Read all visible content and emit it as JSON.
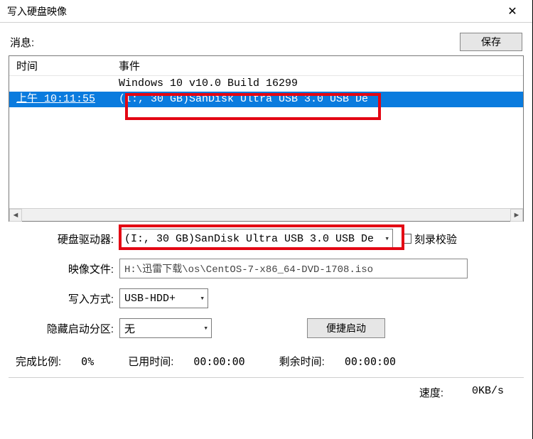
{
  "titlebar": {
    "title": "写入硬盘映像"
  },
  "messages": {
    "label": "消息:",
    "save_button": "保存"
  },
  "log": {
    "col_time": "时间",
    "col_event": "事件",
    "rows": [
      {
        "time": "",
        "event": "Windows 10 v10.0 Build 16299"
      },
      {
        "time": "上午 10:11:55",
        "event": "(I:, 30 GB)SanDisk Ultra USB 3.0 USB De"
      }
    ]
  },
  "form": {
    "drive_label": "硬盘驱动器:",
    "drive_value": "(I:, 30 GB)SanDisk Ultra USB 3.0 USB De",
    "verify_label": "刻录校验",
    "image_label": "映像文件:",
    "image_value": "H:\\迅雷下载\\os\\CentOS-7-x86_64-DVD-1708.iso",
    "write_mode_label": "写入方式:",
    "write_mode_value": "USB-HDD+",
    "hidden_boot_label": "隐藏启动分区:",
    "hidden_boot_value": "无",
    "portable_button": "便捷启动"
  },
  "status": {
    "done_label": "完成比例:",
    "done_value": "0%",
    "elapsed_label": "已用时间:",
    "elapsed_value": "00:00:00",
    "remain_label": "剩余时间:",
    "remain_value": "00:00:00"
  },
  "speed": {
    "label": "速度:",
    "value": "0KB/s"
  }
}
